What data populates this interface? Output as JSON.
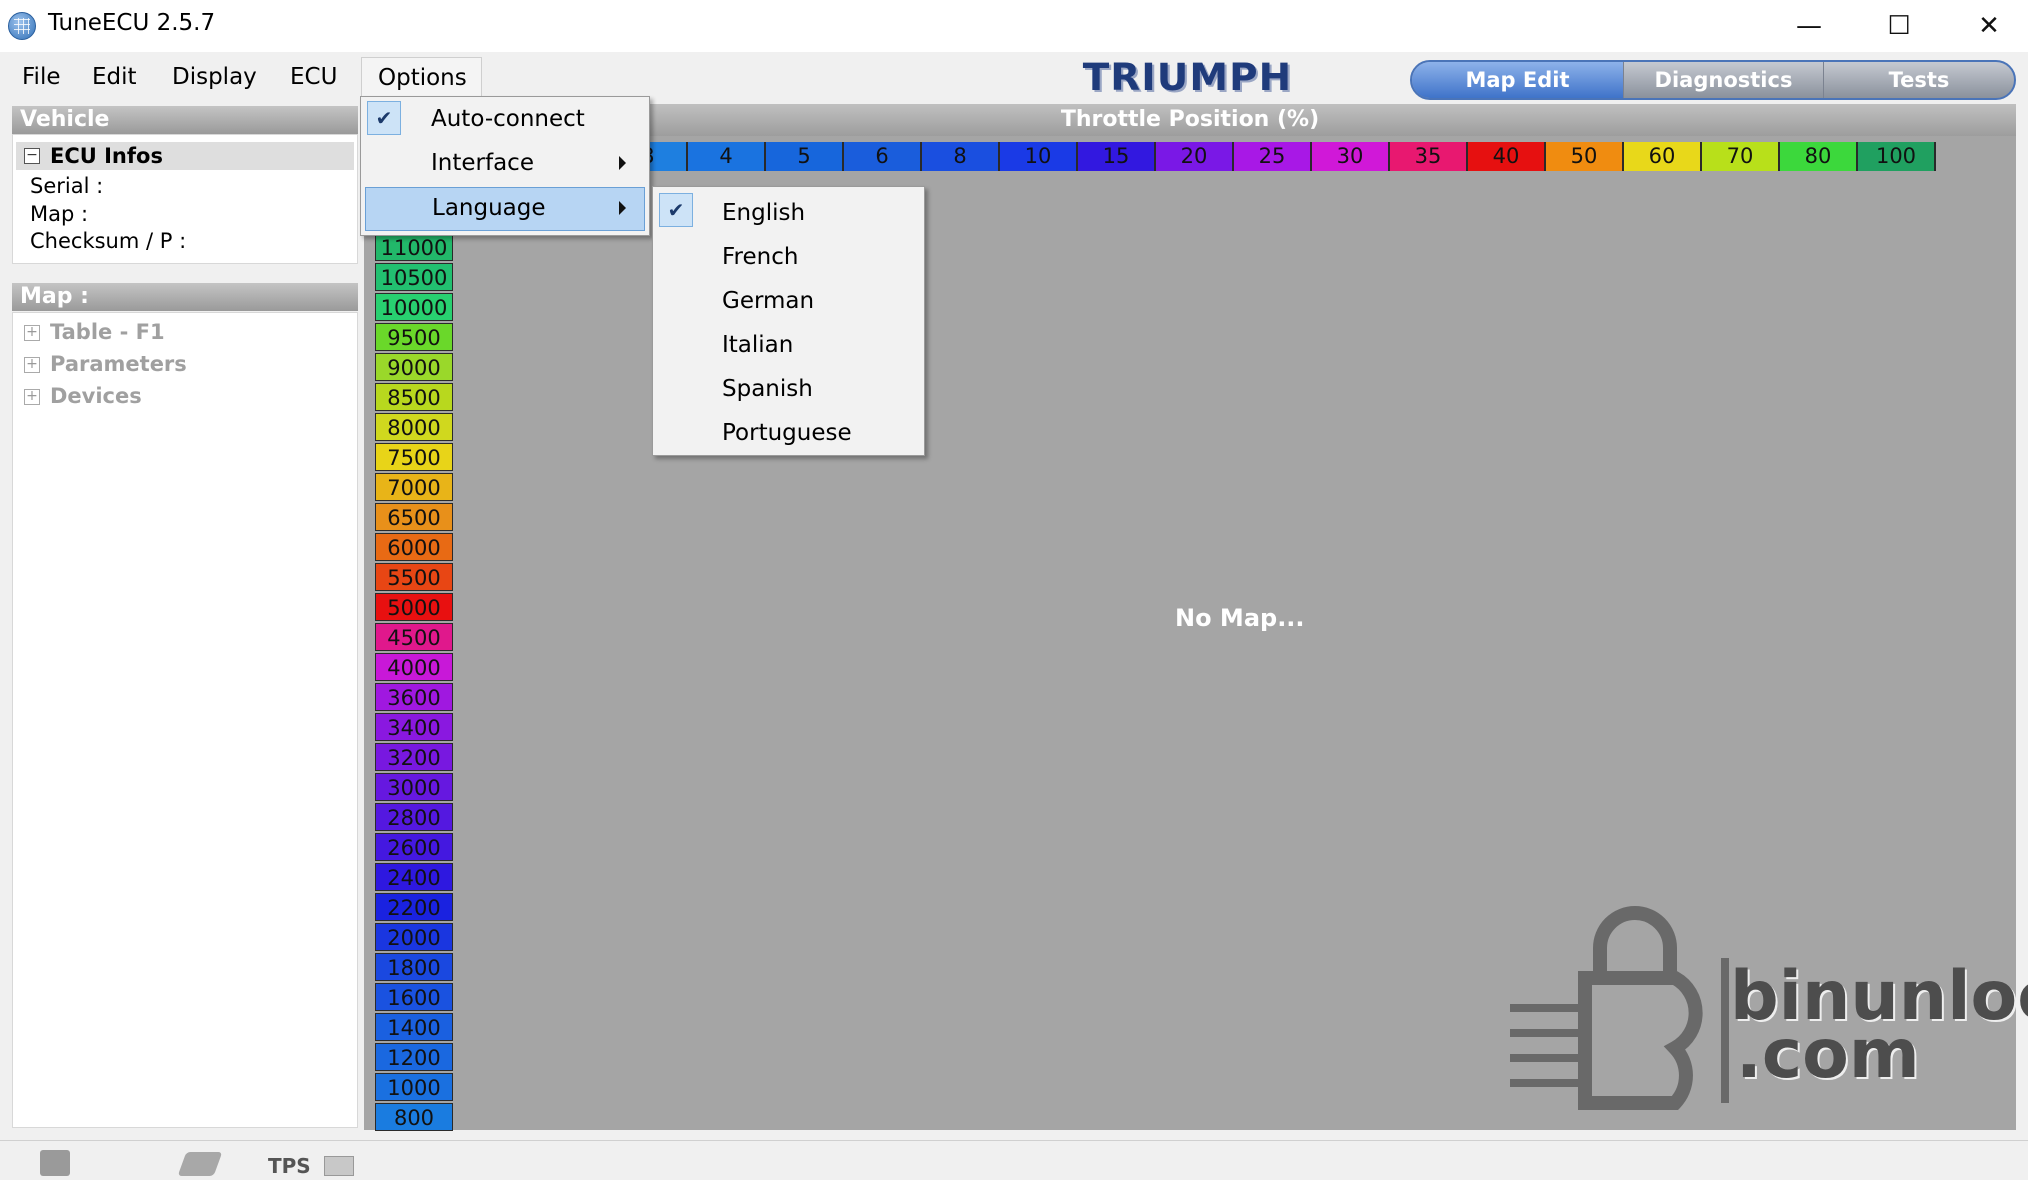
{
  "window": {
    "title": "TuneECU 2.5.7",
    "minimize": "—",
    "maximize": "☐",
    "close": "✕"
  },
  "menubar": [
    "File",
    "Edit",
    "Display",
    "ECU",
    "Options"
  ],
  "logo": "TRIUMPH",
  "tabs": [
    "Map Edit",
    "Diagnostics",
    "Tests"
  ],
  "vehicle": {
    "header": "Vehicle",
    "ecu_infos": "ECU Infos",
    "serial": "Serial :",
    "map": "Map :",
    "checksum": "Checksum / P :"
  },
  "map_panel": {
    "header": "Map :",
    "items": [
      "Table - F1",
      "Parameters",
      "Devices"
    ]
  },
  "throttle": {
    "header": "Throttle Position (%)",
    "cells": [
      {
        "label": "3",
        "color": "#1e7fe0"
      },
      {
        "label": "4",
        "color": "#1a73e0"
      },
      {
        "label": "5",
        "color": "#1766dc"
      },
      {
        "label": "6",
        "color": "#1a5ddc"
      },
      {
        "label": "8",
        "color": "#1a4fe0"
      },
      {
        "label": "10",
        "color": "#1a3ae6"
      },
      {
        "label": "15",
        "color": "#3218e0"
      },
      {
        "label": "20",
        "color": "#7a18e6"
      },
      {
        "label": "25",
        "color": "#a818e6"
      },
      {
        "label": "30",
        "color": "#d018d8"
      },
      {
        "label": "35",
        "color": "#e81870"
      },
      {
        "label": "40",
        "color": "#e61010"
      },
      {
        "label": "50",
        "color": "#f08c10"
      },
      {
        "label": "60",
        "color": "#e8d81a"
      },
      {
        "label": "70",
        "color": "#b8e01a"
      },
      {
        "label": "80",
        "color": "#3cd83c"
      },
      {
        "label": "100",
        "color": "#20a060"
      }
    ]
  },
  "rpm": [
    {
      "label": "11000",
      "color": "#22b86a"
    },
    {
      "label": "10500",
      "color": "#22c070"
    },
    {
      "label": "10000",
      "color": "#28d070"
    },
    {
      "label": "9500",
      "color": "#6ad82a"
    },
    {
      "label": "9000",
      "color": "#9ad82a"
    },
    {
      "label": "8500",
      "color": "#b8d81e"
    },
    {
      "label": "8000",
      "color": "#d0d81e"
    },
    {
      "label": "7500",
      "color": "#e8d418"
    },
    {
      "label": "7000",
      "color": "#e8b418"
    },
    {
      "label": "6500",
      "color": "#e8901a"
    },
    {
      "label": "6000",
      "color": "#e86a14"
    },
    {
      "label": "5500",
      "color": "#e84614"
    },
    {
      "label": "5000",
      "color": "#e81010"
    },
    {
      "label": "4500",
      "color": "#e0188c"
    },
    {
      "label": "4000",
      "color": "#c818d8"
    },
    {
      "label": "3600",
      "color": "#a018e0"
    },
    {
      "label": "3400",
      "color": "#8a18e0"
    },
    {
      "label": "3200",
      "color": "#7818e0"
    },
    {
      "label": "3000",
      "color": "#6618e0"
    },
    {
      "label": "2800",
      "color": "#5418e0"
    },
    {
      "label": "2600",
      "color": "#4418e0"
    },
    {
      "label": "2400",
      "color": "#2e18e0"
    },
    {
      "label": "2200",
      "color": "#1a22e0"
    },
    {
      "label": "2000",
      "color": "#1a36e0"
    },
    {
      "label": "1800",
      "color": "#1a48e0"
    },
    {
      "label": "1600",
      "color": "#1a52e0"
    },
    {
      "label": "1400",
      "color": "#1a60e0"
    },
    {
      "label": "1200",
      "color": "#1a68e0"
    },
    {
      "label": "1000",
      "color": "#1a70e0"
    },
    {
      "label": "800",
      "color": "#1a7ce0"
    }
  ],
  "no_map": "No Map...",
  "options_menu": [
    "Auto-connect",
    "Interface",
    "Language"
  ],
  "language_menu": [
    "English",
    "French",
    "German",
    "Italian",
    "Spanish",
    "Portuguese"
  ],
  "watermark": {
    "line1": "binunlock",
    "line2": ".com"
  },
  "statusbar": {
    "tps": "TPS"
  }
}
